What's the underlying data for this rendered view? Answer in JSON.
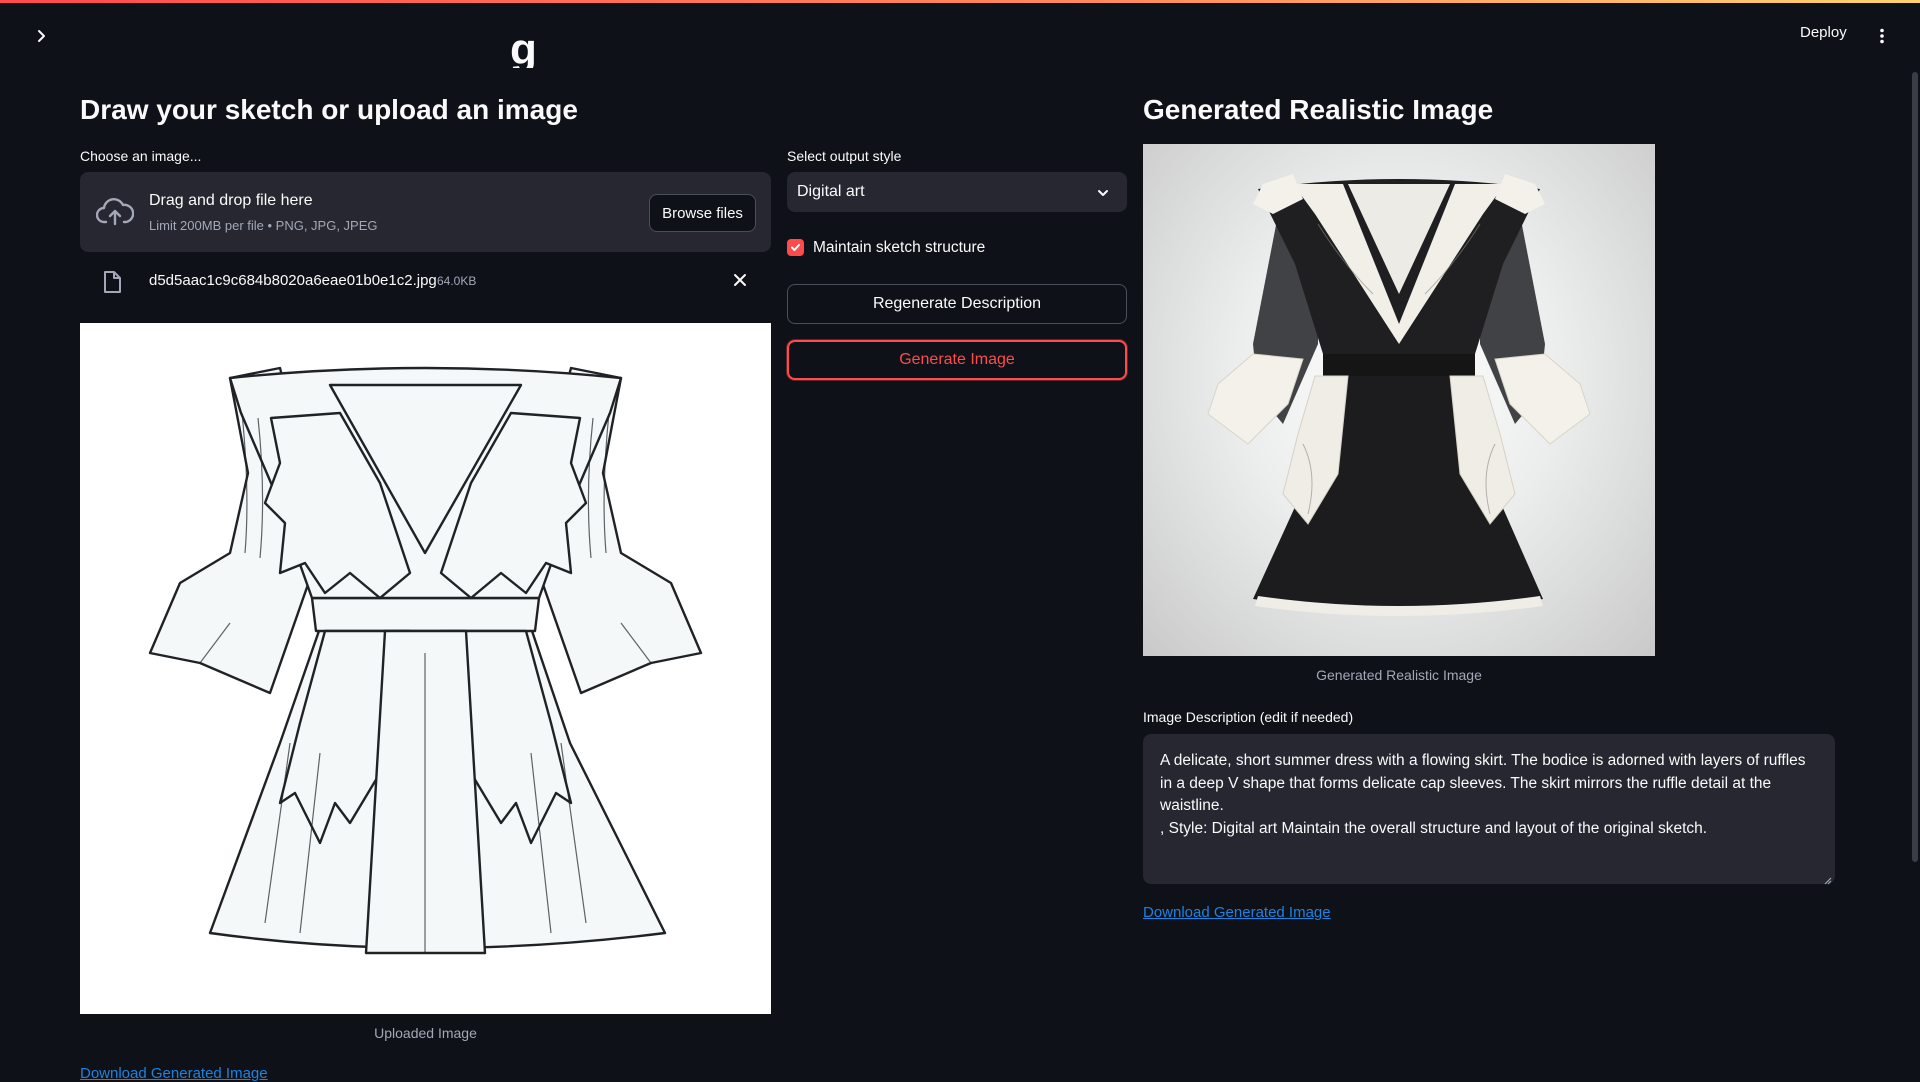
{
  "header": {
    "deploy_label": "Deploy",
    "title_fragment": "g"
  },
  "left": {
    "heading": "Draw your sketch or upload an image",
    "uploader_label": "Choose an image...",
    "dropzone_title": "Drag and drop file here",
    "dropzone_subtitle": "Limit 200MB per file • PNG, JPG, JPEG",
    "browse_label": "Browse files",
    "file_name": "d5d5aac1c9c684b8020a6eae01b0e1c2.jpg",
    "file_size": "64.0KB",
    "image_caption": "Uploaded Image",
    "download_link": "Download Generated Image"
  },
  "middle": {
    "select_label": "Select output style",
    "select_value": "Digital art",
    "checkbox_label": "Maintain sketch structure",
    "checkbox_checked": true,
    "regenerate_label": "Regenerate Description",
    "generate_label": "Generate Image"
  },
  "right": {
    "heading": "Generated Realistic Image",
    "image_caption": "Generated Realistic Image",
    "description_label": "Image Description (edit if needed)",
    "description_text": "A delicate, short summer dress with a flowing skirt. The bodice is adorned with layers of ruffles in a deep V shape that forms delicate cap sleeves. The skirt mirrors the ruffle detail at the waistline.\n, Style: Digital art Maintain the overall structure and layout of the original sketch.",
    "download_link": "Download Generated Image"
  },
  "colors": {
    "background": "#0e1117",
    "panel": "#262730",
    "accent": "#ff4b4b",
    "link": "#1c83e1",
    "muted_text": "#a3a8b8"
  }
}
